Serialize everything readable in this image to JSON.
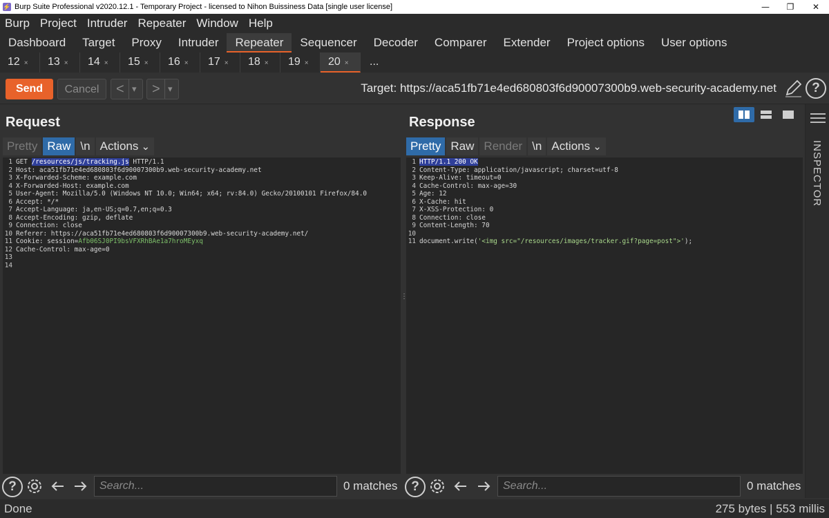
{
  "window": {
    "title": "Burp Suite Professional v2020.12.1 - Temporary Project - licensed to Nihon Buissiness Data [single user license]",
    "minimize_glyph": "—",
    "restore_glyph": "❐",
    "close_glyph": "✕"
  },
  "menu": [
    "Burp",
    "Project",
    "Intruder",
    "Repeater",
    "Window",
    "Help"
  ],
  "main_tabs": [
    "Dashboard",
    "Target",
    "Proxy",
    "Intruder",
    "Repeater",
    "Sequencer",
    "Decoder",
    "Comparer",
    "Extender",
    "Project options",
    "User options"
  ],
  "main_tab_active": "Repeater",
  "repeater_tabs": [
    "12",
    "13",
    "14",
    "15",
    "16",
    "17",
    "18",
    "19",
    "20"
  ],
  "repeater_tab_active": "20",
  "repeater_tab_close": "×",
  "repeater_tab_more": "...",
  "toolbar": {
    "send_label": "Send",
    "cancel_label": "Cancel",
    "back_glyph": "<",
    "forward_glyph": ">",
    "dropdown_glyph": "▾",
    "target": "Target: https://aca51fb71e4ed680803f6d90007300b9.web-security-academy.net",
    "help_glyph": "?"
  },
  "request": {
    "title": "Request",
    "tabs": [
      "Pretty",
      "Raw",
      "\\n",
      "Actions"
    ],
    "active_tab": "Raw",
    "lines": [
      {
        "n": "1",
        "parts": [
          {
            "t": "GET ",
            "c": ""
          },
          {
            "t": "/resources/js/tracking.js",
            "c": "sel"
          },
          {
            "t": " HTTP/1.1",
            "c": ""
          }
        ]
      },
      {
        "n": "2",
        "parts": [
          {
            "t": "Host: aca51fb71e4ed680803f6d90007300b9.web-security-academy.net",
            "c": ""
          }
        ]
      },
      {
        "n": "3",
        "parts": [
          {
            "t": "X-Forwarded-Scheme: example.com",
            "c": ""
          }
        ]
      },
      {
        "n": "4",
        "parts": [
          {
            "t": "X-Forwarded-Host: example.com",
            "c": ""
          }
        ]
      },
      {
        "n": "5",
        "parts": [
          {
            "t": "User-Agent: Mozilla/5.0 (Windows NT 10.0; Win64; x64; rv:84.0) Gecko/20100101 Firefox/84.0",
            "c": ""
          }
        ]
      },
      {
        "n": "6",
        "parts": [
          {
            "t": "Accept: */*",
            "c": ""
          }
        ]
      },
      {
        "n": "7",
        "parts": [
          {
            "t": "Accept-Language: ja,en-US;q=0.7,en;q=0.3",
            "c": ""
          }
        ]
      },
      {
        "n": "8",
        "parts": [
          {
            "t": "Accept-Encoding: gzip, deflate",
            "c": ""
          }
        ]
      },
      {
        "n": "9",
        "parts": [
          {
            "t": "Connection: close",
            "c": ""
          }
        ]
      },
      {
        "n": "10",
        "parts": [
          {
            "t": "Referer: https://aca51fb71e4ed680803f6d90007300b9.web-security-academy.net/",
            "c": ""
          }
        ]
      },
      {
        "n": "11",
        "parts": [
          {
            "t": "Cookie: session=",
            "c": ""
          },
          {
            "t": "Afb06SJ0PI9bsVFXRhBAe1a7hroMEyxq",
            "c": "grn"
          }
        ]
      },
      {
        "n": "12",
        "parts": [
          {
            "t": "Cache-Control: max-age=0",
            "c": ""
          }
        ]
      },
      {
        "n": "13",
        "parts": []
      },
      {
        "n": "14",
        "parts": []
      }
    ]
  },
  "response": {
    "title": "Response",
    "tabs": [
      "Pretty",
      "Raw",
      "Render",
      "\\n",
      "Actions"
    ],
    "active_tab": "Pretty",
    "lines": [
      {
        "n": "1",
        "parts": [
          {
            "t": "HTTP/1.1 200 OK",
            "c": "sel"
          }
        ]
      },
      {
        "n": "2",
        "parts": [
          {
            "t": "Content-Type: application/javascript; charset=utf-8",
            "c": ""
          }
        ]
      },
      {
        "n": "3",
        "parts": [
          {
            "t": "Keep-Alive: timeout=0",
            "c": ""
          }
        ]
      },
      {
        "n": "4",
        "parts": [
          {
            "t": "Cache-Control: max-age=30",
            "c": ""
          }
        ]
      },
      {
        "n": "5",
        "parts": [
          {
            "t": "Age: 12",
            "c": ""
          }
        ]
      },
      {
        "n": "6",
        "parts": [
          {
            "t": "X-Cache: hit",
            "c": ""
          }
        ]
      },
      {
        "n": "7",
        "parts": [
          {
            "t": "X-XSS-Protection: 0",
            "c": ""
          }
        ]
      },
      {
        "n": "8",
        "parts": [
          {
            "t": "Connection: close",
            "c": ""
          }
        ]
      },
      {
        "n": "9",
        "parts": [
          {
            "t": "Content-Length: 70",
            "c": ""
          }
        ]
      },
      {
        "n": "10",
        "parts": []
      },
      {
        "n": "11",
        "parts": [
          {
            "t": "document.write(",
            "c": ""
          },
          {
            "t": "'<img src=\"/resources/images/tracker.gif?page=post\">'",
            "c": "str"
          },
          {
            "t": ");",
            "c": ""
          }
        ]
      }
    ]
  },
  "inspector_label": "INSPECTOR",
  "search": {
    "placeholder": "Search...",
    "request_matches": "0 matches",
    "response_matches": "0 matches"
  },
  "status": {
    "left": "Done",
    "right": "275 bytes | 553 millis"
  },
  "colors": {
    "accent": "#e8622a",
    "active_tab_blue": "#2f6ba8",
    "background": "#323232",
    "editor_bg": "#262626"
  }
}
